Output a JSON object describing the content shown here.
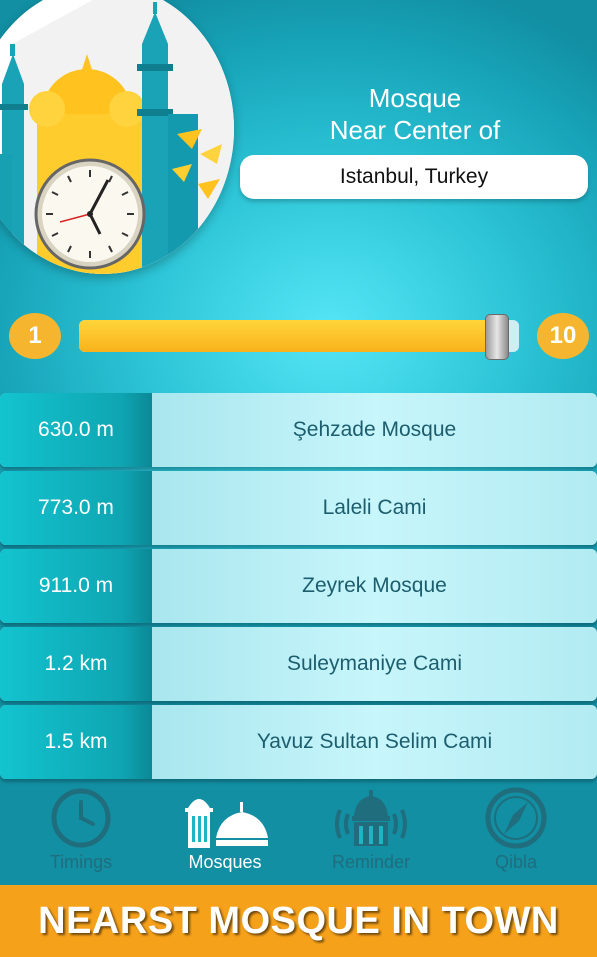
{
  "header": {
    "title_line1": "Mosque",
    "title_line2": "Near Center of",
    "location": "Istanbul, Turkey"
  },
  "slider": {
    "min_label": "1",
    "max_label": "10",
    "value": 10,
    "min": 1,
    "max": 10
  },
  "mosques": [
    {
      "distance": "630.0 m",
      "name": "Şehzade Mosque"
    },
    {
      "distance": "773.0 m",
      "name": "Laleli Cami"
    },
    {
      "distance": "911.0 m",
      "name": "Zeyrek Mosque"
    },
    {
      "distance": "1.2 km",
      "name": "Suleymaniye Cami"
    },
    {
      "distance": "1.5 km",
      "name": "Yavuz Sultan Selim Cami"
    }
  ],
  "nav": {
    "timings": {
      "label": "Timings",
      "icon": "clock-icon"
    },
    "mosques": {
      "label": "Mosques",
      "icon": "mosque-icon"
    },
    "reminder": {
      "label": "Reminder",
      "icon": "mosque-sound-icon"
    },
    "qibla": {
      "label": "Qibla",
      "icon": "compass-icon"
    },
    "active": "mosques"
  },
  "banner": {
    "text": "NEARST MOSQUE IN TOWN"
  },
  "colors": {
    "accent": "#f5b52e",
    "teal": "#1fb3c4",
    "banner": "#f6a11a"
  }
}
